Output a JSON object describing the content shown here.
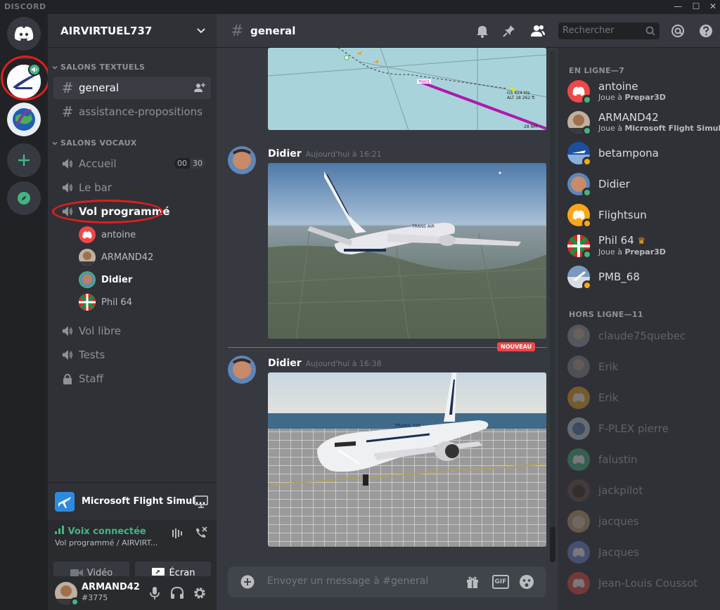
{
  "app": {
    "brand": "DISCORD"
  },
  "server": {
    "name": "AIRVIRTUEL737"
  },
  "categories": {
    "text": "SALONS TEXTUELS",
    "voice": "SALONS VOCAUX"
  },
  "text_channels": [
    {
      "name": "general"
    },
    {
      "name": "assistance-propositions"
    }
  ],
  "voice_channels": [
    {
      "name": "Accueil",
      "count": "00",
      "limit": "30"
    },
    {
      "name": "Le bar"
    },
    {
      "name": "Vol programmé"
    },
    {
      "name": "Vol libre"
    },
    {
      "name": "Tests"
    },
    {
      "name": "Staff"
    }
  ],
  "voice_users": [
    "antoine",
    "ARMAND42",
    "Didier",
    "Phil 64"
  ],
  "activity": {
    "title": "Microsoft Flight Simul..."
  },
  "voice_panel": {
    "status": "Voix connectée",
    "channel": "Vol programmé / AIRVIRT...",
    "video_label": "Vidéo",
    "screen_label": "Écran"
  },
  "user": {
    "name": "ARMAND42",
    "tag": "#3775"
  },
  "chat": {
    "channel": "general",
    "search_placeholder": "Rechercher",
    "composer_placeholder": "Envoyer un message à #general",
    "new_label": "NOUVEAU",
    "gif_label": "GIF",
    "messages": [
      {
        "author": "Didier",
        "time": "Aujourd'hui à 16:21"
      },
      {
        "author": "Didier",
        "time": "Aujourd'hui à 16:38"
      }
    ],
    "map_labels": {
      "speed": "GS 424 kts",
      "alt": "ALT 18 262 ft",
      "tag": "TRA01",
      "corner": "28 NM"
    },
    "plane_livery": "TRANS AIR"
  },
  "members": {
    "online_header": "EN LIGNE—7",
    "offline_header": "HORS LIGNE—11",
    "online": [
      {
        "name": "antoine",
        "prefix": "Joue à",
        "game": "Prepar3D",
        "status": "online"
      },
      {
        "name": "ARMAND42",
        "prefix": "Joue à",
        "game": "Microsoft Flight Simula...",
        "status": "online"
      },
      {
        "name": "betampona",
        "status": "idle"
      },
      {
        "name": "Didier",
        "status": "online"
      },
      {
        "name": "Flightsun",
        "status": "idle"
      },
      {
        "name": "Phil 64",
        "prefix": "Joue à",
        "game": "Prepar3D",
        "status": "online"
      },
      {
        "name": "PMB_68",
        "status": "idle"
      }
    ],
    "offline": [
      "claude75quebec",
      "Erik",
      "Erik",
      "F-PLEX pierre",
      "falustin",
      "jackpilot",
      "jacques",
      "Jacques",
      "Jean-Louis Coussot"
    ]
  },
  "colors": {
    "online": "#43b581",
    "idle": "#faa61a",
    "accent": "#7289da",
    "new": "#f04747"
  }
}
